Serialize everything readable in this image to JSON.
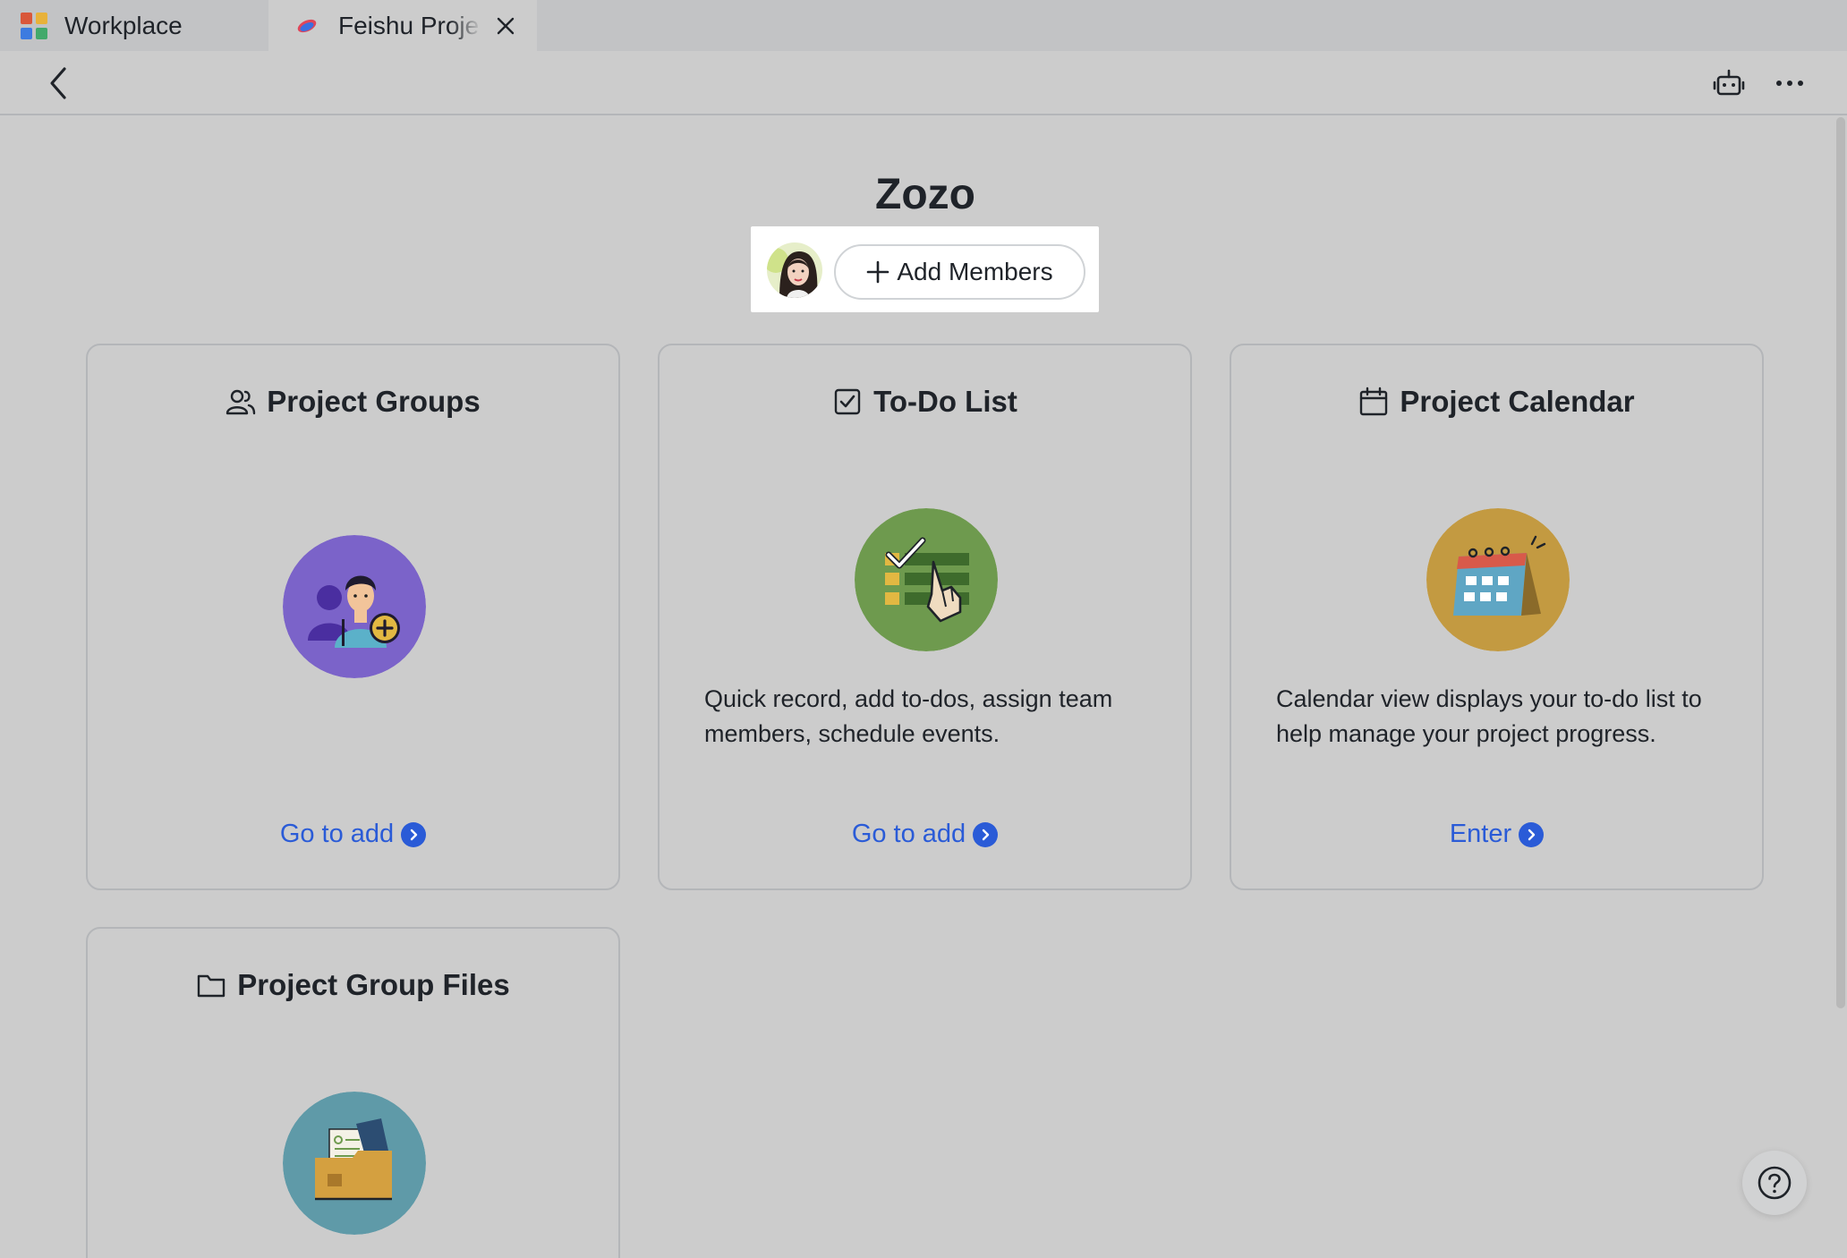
{
  "tabs": [
    {
      "label": "Workplace",
      "icon": "grid-apps-icon",
      "active": false
    },
    {
      "label": "Feishu Proje",
      "icon": "feishu-logo-icon",
      "active": true
    }
  ],
  "toolbar": {
    "back_icon": "chevron-left-icon",
    "bot_icon": "robot-icon",
    "more_icon": "more-dots-icon"
  },
  "header": {
    "title": "Zozo",
    "add_members_label": "Add Members"
  },
  "cards": [
    {
      "title": "Project Groups",
      "icon": "group-people-icon",
      "illustration": "add-person-illustration",
      "description": "",
      "link": "Go to add",
      "accent": "#7b63c9"
    },
    {
      "title": "To-Do List",
      "icon": "checkbox-icon",
      "illustration": "todo-checklist-illustration",
      "description": "Quick record, add to-dos, assign team members, schedule events.",
      "link": "Go to add",
      "accent": "#6e9a4e"
    },
    {
      "title": "Project Calendar",
      "icon": "calendar-icon",
      "illustration": "calendar-illustration",
      "description": "Calendar view displays your to-do list to help manage your project progress.",
      "link": "Enter",
      "accent": "#c39a41"
    },
    {
      "title": "Project Group Files",
      "icon": "folder-icon",
      "illustration": "folder-files-illustration",
      "description": "",
      "link": "",
      "accent": "#5f9aa8"
    }
  ],
  "colors": {
    "link": "#2a5bd7",
    "page_bg": "#cccccc",
    "tab_strip": "#c2c3c5"
  },
  "help_icon": "help-question-icon"
}
